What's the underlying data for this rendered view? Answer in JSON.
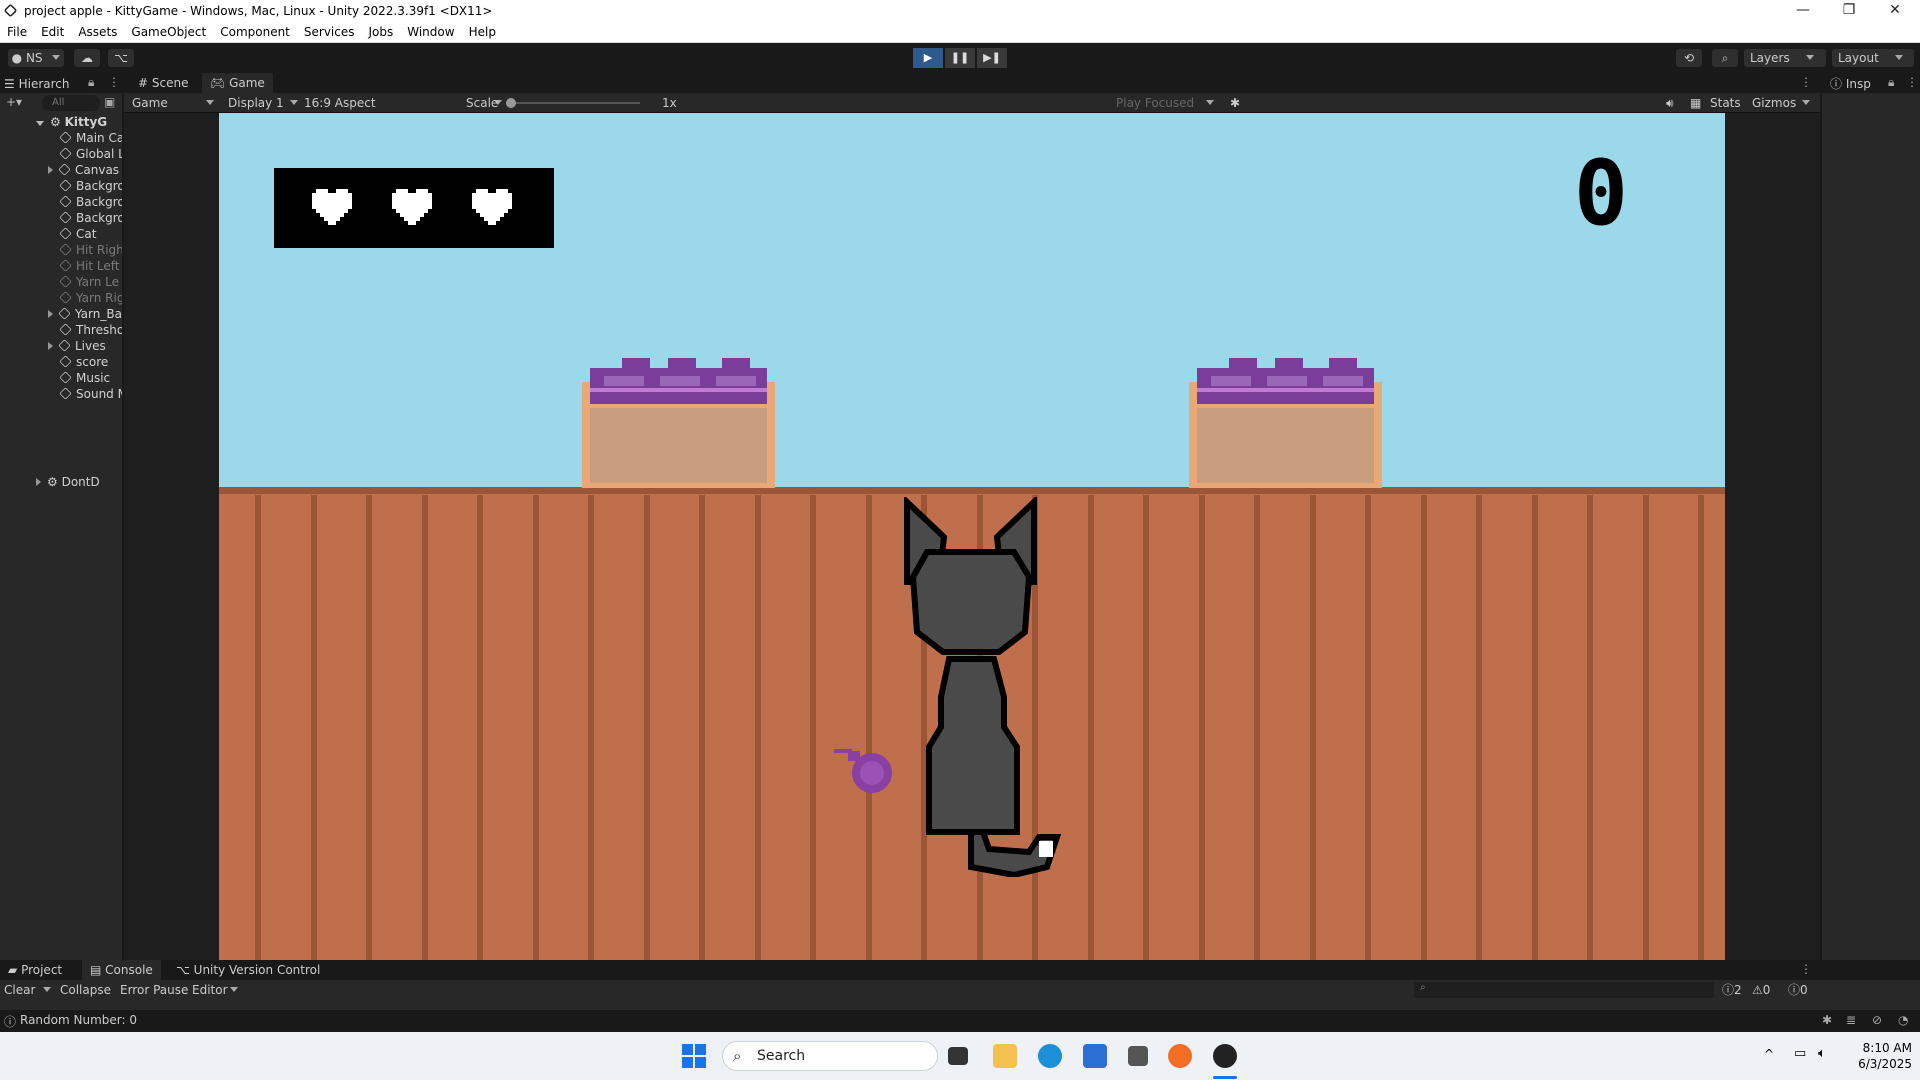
{
  "window": {
    "title": "project apple - KittyGame - Windows, Mac, Linux - Unity 2022.3.39f1 <DX11>",
    "minimize": "—",
    "maximize": "❐",
    "close": "✕"
  },
  "menu": [
    "File",
    "Edit",
    "Assets",
    "GameObject",
    "Component",
    "Services",
    "Jobs",
    "Window",
    "Help"
  ],
  "toolbar": {
    "account": "NS",
    "layers": "Layers",
    "layout": "Layout"
  },
  "hierarchy": {
    "tab": "Hierarch",
    "search_placeholder": "All",
    "scene": "KittyG",
    "items": [
      {
        "label": "Main Ca",
        "dim": false,
        "expand": false
      },
      {
        "label": "Global L",
        "dim": false,
        "expand": false
      },
      {
        "label": "Canvas",
        "dim": false,
        "expand": true
      },
      {
        "label": "Backgro",
        "dim": false,
        "expand": false
      },
      {
        "label": "Backgro",
        "dim": false,
        "expand": false
      },
      {
        "label": "Backgro",
        "dim": false,
        "expand": false
      },
      {
        "label": "Cat",
        "dim": false,
        "expand": false
      },
      {
        "label": "Hit Righ",
        "dim": true,
        "expand": false
      },
      {
        "label": "Hit Left",
        "dim": true,
        "expand": false
      },
      {
        "label": "Yarn Le",
        "dim": true,
        "expand": false
      },
      {
        "label": "Yarn Rig",
        "dim": true,
        "expand": false
      },
      {
        "label": "Yarn_Ba",
        "dim": false,
        "expand": true
      },
      {
        "label": "Thresho",
        "dim": false,
        "expand": false
      },
      {
        "label": "Lives",
        "dim": false,
        "expand": true
      },
      {
        "label": "score",
        "dim": false,
        "expand": false
      },
      {
        "label": "Music",
        "dim": false,
        "expand": false
      },
      {
        "label": "Sound M",
        "dim": false,
        "expand": false
      }
    ],
    "dont_destroy": "DontD"
  },
  "game_view": {
    "tabs": {
      "scene": "Scene",
      "game": "Game"
    },
    "mode": "Game",
    "display": "Display 1",
    "aspect": "16:9 Aspect",
    "scale_label": "Scale",
    "scale_value": "1x",
    "play_focused": "Play Focused",
    "stats": "Stats",
    "gizmos": "Gizmos",
    "score": "0",
    "lives": 3
  },
  "inspector": {
    "tab": "Insp"
  },
  "console": {
    "tabs": {
      "project": "Project",
      "console": "Console",
      "uvc": "Unity Version Control"
    },
    "clear": "Clear",
    "collapse": "Collapse",
    "error_pause": "Error Pause",
    "editor": "Editor",
    "count_info": "2",
    "count_warn": "0",
    "count_error": "0"
  },
  "status": {
    "message": "Random Number: 0"
  },
  "taskbar": {
    "search_placeholder": "Search",
    "time": "8:10 AM",
    "date": "6/3/2025"
  },
  "colors": {
    "sky": "#9bd8ea",
    "fence": "#c06f4c",
    "yarn": "#8a3fa3",
    "cat": "#4a4a4a"
  }
}
